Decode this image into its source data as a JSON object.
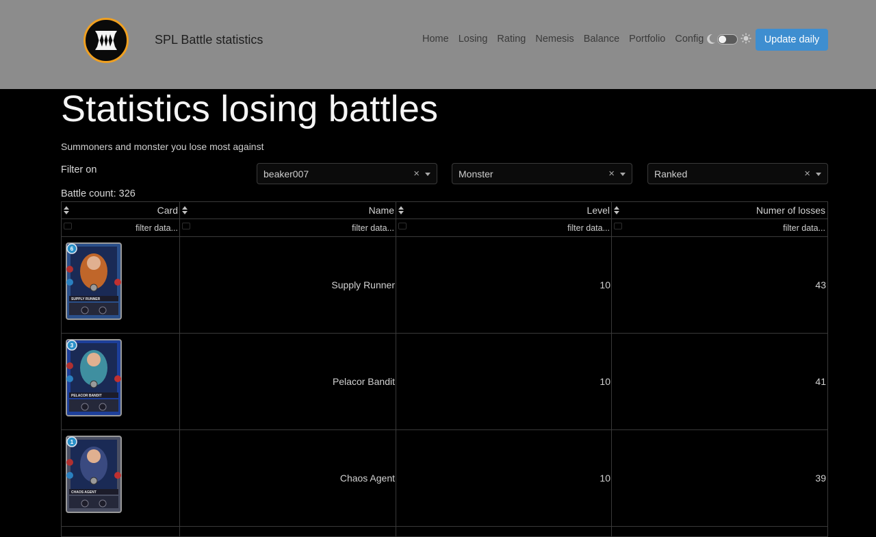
{
  "header": {
    "brand": "SPL Battle statistics",
    "nav": [
      "Home",
      "Losing",
      "Rating",
      "Nemesis",
      "Balance",
      "Portfolio",
      "Config"
    ],
    "update_label": "Update daily",
    "accent": "#3e8ed0",
    "logo_border": "#f0a020"
  },
  "main": {
    "title": "Statistics losing battles",
    "subtitle": "Summoners and monster you lose most against",
    "filter_label": "Filter on",
    "filters": [
      {
        "value": "beaker007",
        "clear": "×"
      },
      {
        "value": "Monster",
        "clear": "×"
      },
      {
        "value": "Ranked",
        "clear": "×"
      }
    ],
    "battle_count": "Battle count: 326"
  },
  "table": {
    "columns": [
      "Card",
      "Name",
      "Level",
      "Numer of losses"
    ],
    "filter_placeholder": "filter data...",
    "rows": [
      {
        "name": "Supply Runner",
        "level": "10",
        "losses": "43",
        "card_color": "#2a4f8a",
        "card_art": "#c0662a",
        "mana": "6",
        "card_title": "SUPPLY RUNNER"
      },
      {
        "name": "Pelacor Bandit",
        "level": "10",
        "losses": "41",
        "card_color": "#1d3f9a",
        "card_art": "#3f8fa0",
        "mana": "3",
        "card_title": "PELACOR BANDIT"
      },
      {
        "name": "Chaos Agent",
        "level": "10",
        "losses": "39",
        "card_color": "#4a4f63",
        "card_art": "#3a4a80",
        "mana": "1",
        "card_title": "CHAOS AGENT"
      }
    ]
  }
}
